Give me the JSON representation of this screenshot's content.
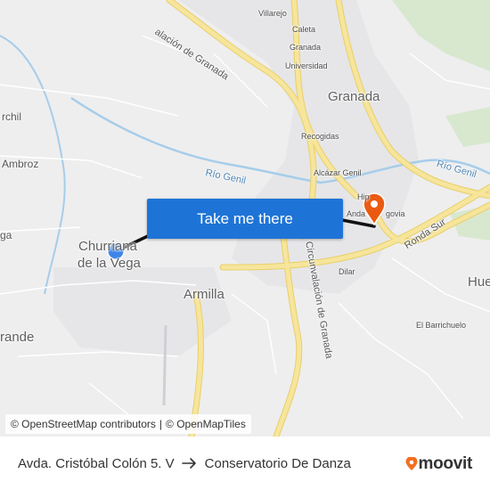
{
  "map": {
    "places": {
      "villarejo": "Villarejo",
      "caleta": "Caleta",
      "granada_small": "Granada",
      "universidad": "Universidad",
      "granada": "Granada",
      "recogidas": "Recogidas",
      "alcazar_genil": "Alcázar Genil",
      "hipercor_partial": "Hip",
      "andalucia_partial": "Anda",
      "segovia_partial": "govia",
      "dilar": "Dilar",
      "churriana_line1": "Churriana",
      "churriana_line2": "de la Vega",
      "armilla": "Armilla",
      "ambroz_partial": "Ambroz",
      "archil_partial": "rchil",
      "vega_partial": "ga",
      "grande_partial": "rande",
      "huetor_partial": "Hue",
      "el_barrichuelo": "El Barrichuelo"
    },
    "roads": {
      "circunvalacion_top": "alación de Granada",
      "circunvalacion_vertical": "Circunvalación de Granada",
      "ronda_sur": "Ronda Sur"
    },
    "rivers": {
      "rio_genil_left": "Río Genil",
      "rio_genil_right": "Río Genil"
    },
    "colors": {
      "land": "#eeeeef",
      "road": "#f6e59b",
      "road_edge": "#e9cf6a",
      "water": "#a6cdea",
      "park": "#cfe4c3",
      "origin_marker": "#3d86e8",
      "destination_marker": "#ea5a12",
      "route": "#111111"
    }
  },
  "cta": {
    "label": "Take me there"
  },
  "attribution": {
    "osm": "© OpenStreetMap contributors",
    "separator": "|",
    "omt": "© OpenMapTiles"
  },
  "trip": {
    "from": "Avda. Cristóbal Colón 5. V",
    "to": "Conservatorio De Danza"
  },
  "brand": {
    "name": "moovit",
    "color": "#f36f21"
  }
}
